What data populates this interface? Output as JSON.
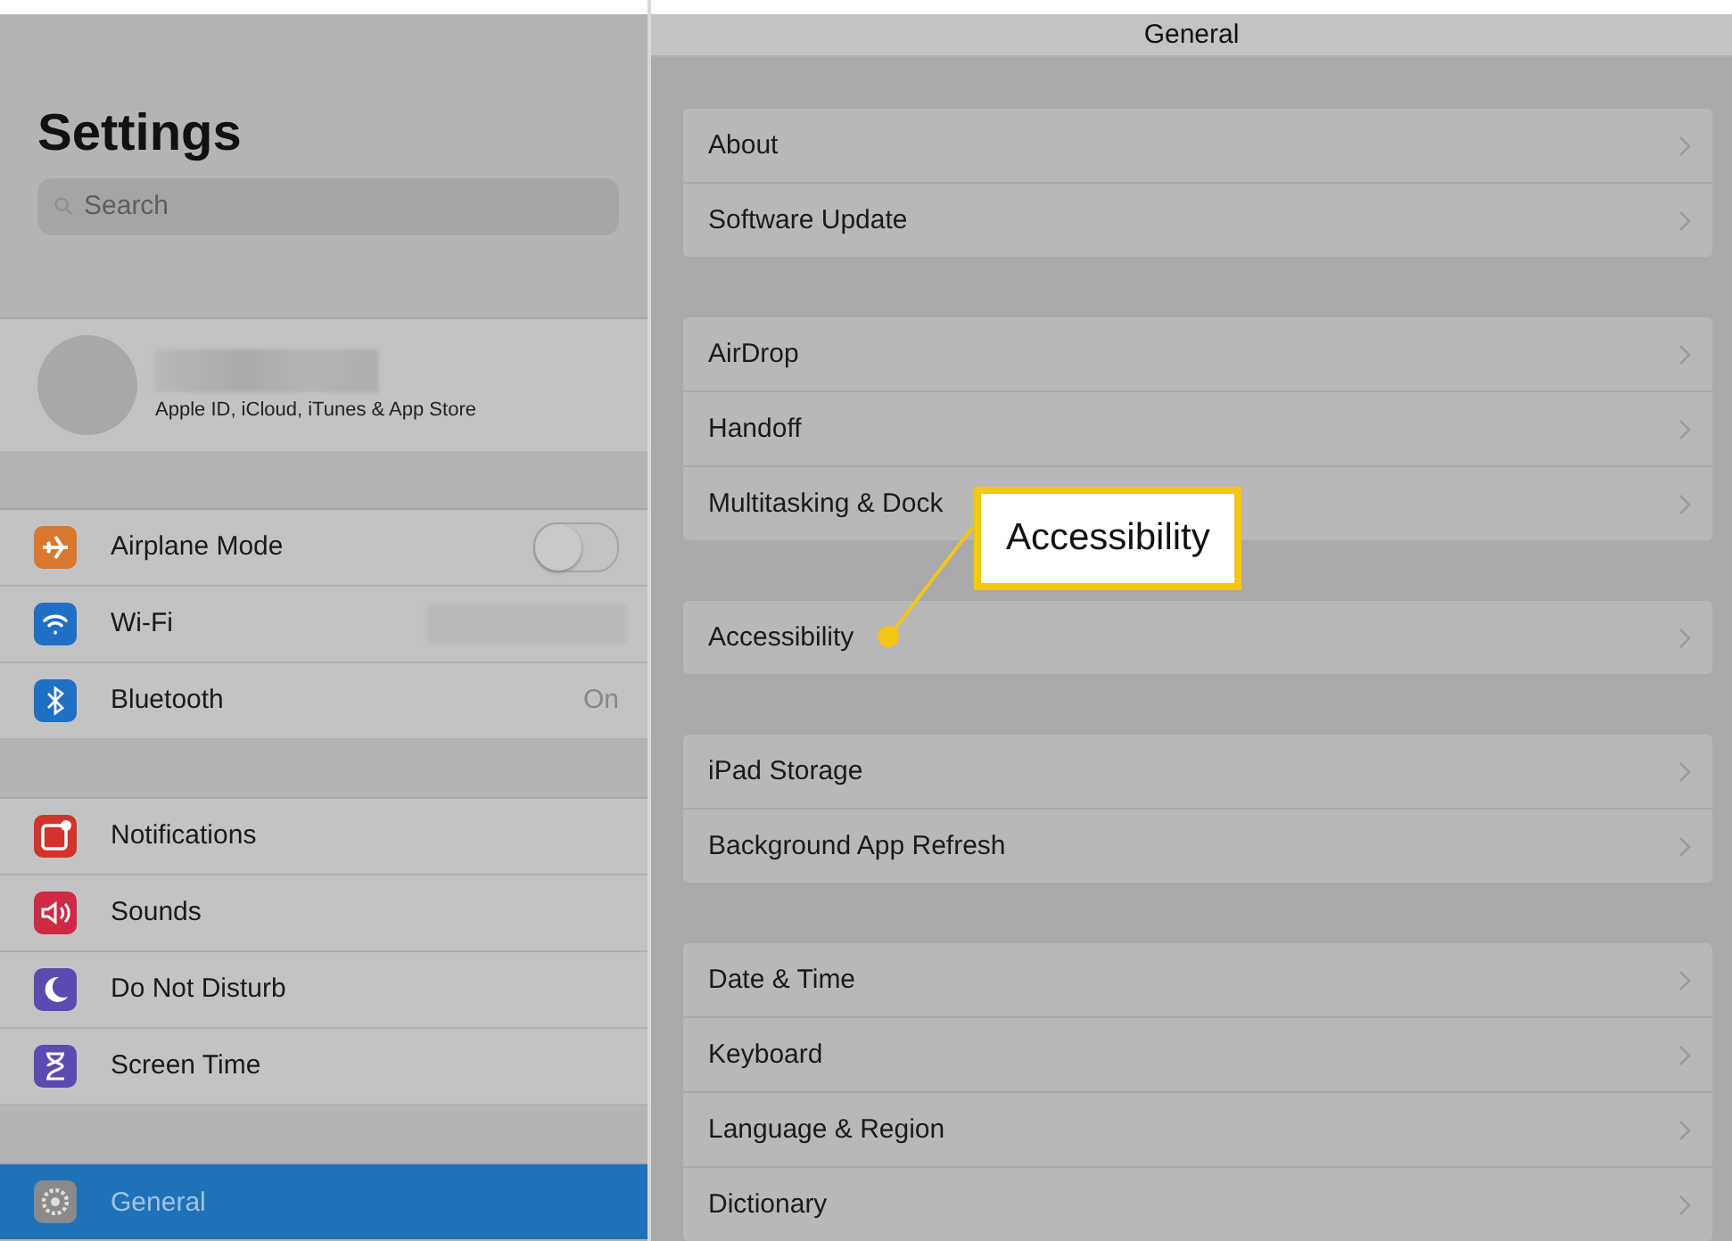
{
  "sidebar": {
    "title": "Settings",
    "search": {
      "placeholder": "Search"
    },
    "profile": {
      "subtitle": "Apple ID, iCloud, iTunes & App Store"
    },
    "groups": [
      [
        {
          "label": "Airplane Mode",
          "color": "#d9782c",
          "kind": "toggle",
          "on": false,
          "selected": false
        },
        {
          "label": "Wi-Fi",
          "color": "#1f6fc4",
          "kind": "redacted",
          "selected": false
        },
        {
          "label": "Bluetooth",
          "color": "#1f6fc4",
          "kind": "value",
          "value": "On",
          "selected": false
        }
      ],
      [
        {
          "label": "Notifications",
          "color": "#d2332c",
          "kind": "plain",
          "selected": false
        },
        {
          "label": "Sounds",
          "color": "#cf2a45",
          "kind": "plain",
          "selected": false
        },
        {
          "label": "Do Not Disturb",
          "color": "#5a4bb0",
          "kind": "plain",
          "selected": false
        },
        {
          "label": "Screen Time",
          "color": "#5a4bb0",
          "kind": "plain",
          "selected": false
        }
      ],
      [
        {
          "label": "General",
          "color": "#8a8a8a",
          "kind": "plain",
          "selected": true
        }
      ]
    ]
  },
  "detail": {
    "title": "General",
    "groups": [
      [
        {
          "label": "About"
        },
        {
          "label": "Software Update"
        }
      ],
      [
        {
          "label": "AirDrop"
        },
        {
          "label": "Handoff"
        },
        {
          "label": "Multitasking & Dock"
        }
      ],
      [
        {
          "label": "Accessibility"
        }
      ],
      [
        {
          "label": "iPad Storage"
        },
        {
          "label": "Background App Refresh"
        }
      ],
      [
        {
          "label": "Date & Time"
        },
        {
          "label": "Keyboard"
        },
        {
          "label": "Language & Region"
        },
        {
          "label": "Dictionary"
        }
      ]
    ]
  },
  "callout": {
    "text": "Accessibility"
  }
}
